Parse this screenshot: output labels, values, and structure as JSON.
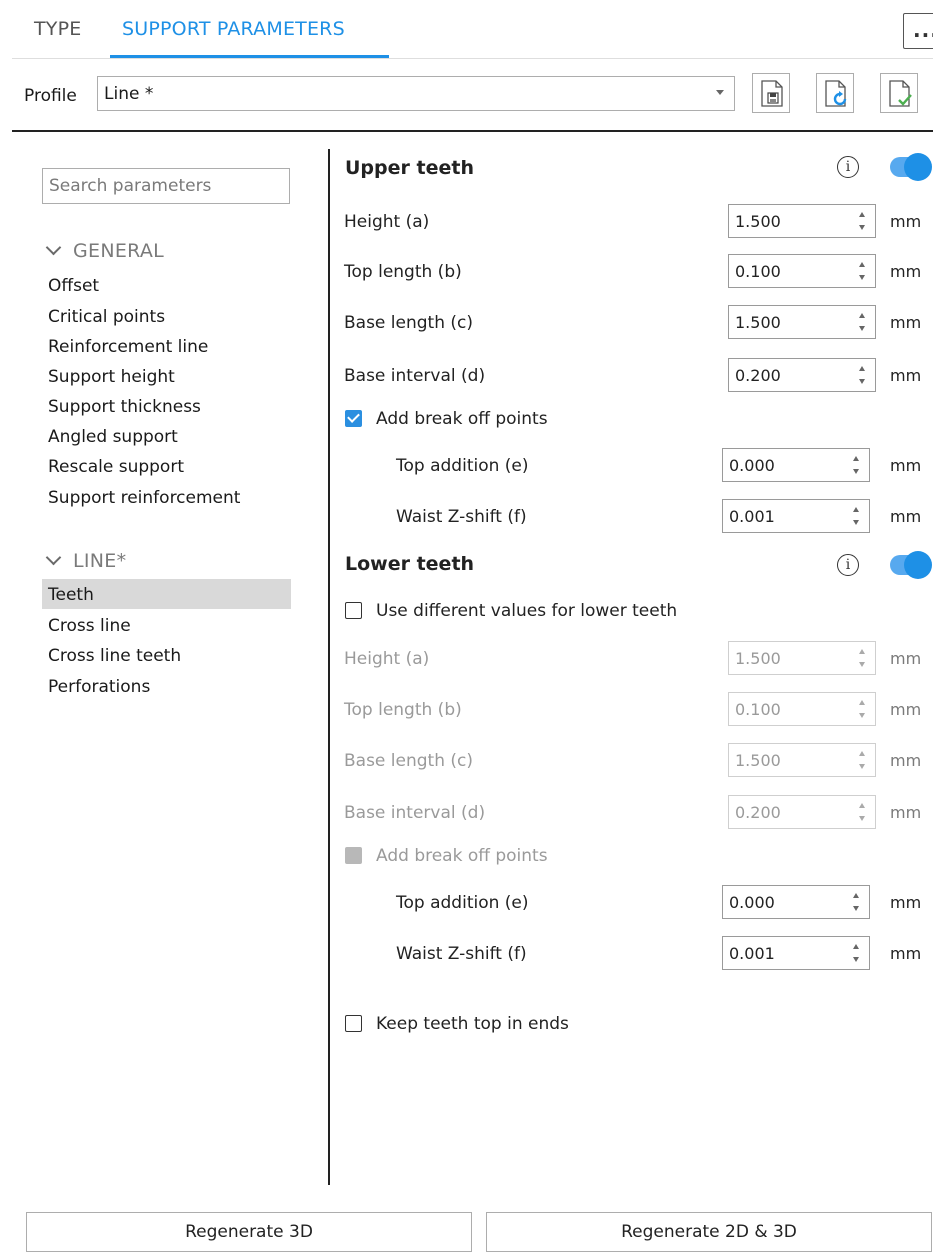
{
  "tabs": [
    {
      "label": "TYPE",
      "active": false
    },
    {
      "label": "SUPPORT PARAMETERS",
      "active": true
    }
  ],
  "more_button": {
    "label": "..."
  },
  "profile": {
    "label": "Profile",
    "selected": "Line *",
    "icons": [
      "save-profile-icon",
      "reset-profile-icon",
      "apply-profile-icon"
    ]
  },
  "sidebar": {
    "search_placeholder": "Search parameters",
    "groups": [
      {
        "title": "GENERAL",
        "items": [
          "Offset",
          "Critical points",
          "Reinforcement line",
          "Support height",
          "Support thickness",
          "Angled support",
          "Rescale support",
          "Support reinforcement"
        ]
      },
      {
        "title": "LINE*",
        "items": [
          "Teeth",
          "Cross line",
          "Cross line teeth",
          "Perforations"
        ]
      }
    ],
    "selected_item": "Teeth"
  },
  "upper": {
    "title": "Upper teeth",
    "enabled": true,
    "params": [
      {
        "label": "Height (a)",
        "value": "1.500",
        "unit": "mm"
      },
      {
        "label": "Top length (b)",
        "value": "0.100",
        "unit": "mm"
      },
      {
        "label": "Base length (c)",
        "value": "1.500",
        "unit": "mm"
      },
      {
        "label": "Base interval (d)",
        "value": "0.200",
        "unit": "mm"
      }
    ],
    "break_off": {
      "label": "Add break off points",
      "checked": true
    },
    "sub_params": [
      {
        "label": "Top addition (e)",
        "value": "0.000",
        "unit": "mm"
      },
      {
        "label": "Waist Z-shift (f)",
        "value": "0.001",
        "unit": "mm"
      }
    ]
  },
  "lower": {
    "title": "Lower teeth",
    "enabled": true,
    "use_different": {
      "label": "Use different values for lower teeth",
      "checked": false
    },
    "params": [
      {
        "label": "Height (a)",
        "value": "1.500",
        "unit": "mm"
      },
      {
        "label": "Top length (b)",
        "value": "0.100",
        "unit": "mm"
      },
      {
        "label": "Base length (c)",
        "value": "1.500",
        "unit": "mm"
      },
      {
        "label": "Base interval (d)",
        "value": "0.200",
        "unit": "mm"
      }
    ],
    "break_off": {
      "label": "Add break off points",
      "checked": true
    },
    "sub_params": [
      {
        "label": "Top addition (e)",
        "value": "0.000",
        "unit": "mm"
      },
      {
        "label": "Waist Z-shift (f)",
        "value": "0.001",
        "unit": "mm"
      }
    ]
  },
  "keep_teeth": {
    "label": "Keep teeth top in ends",
    "checked": false
  },
  "buttons": {
    "regen3d": "Regenerate 3D",
    "regen2d3d": "Regenerate 2D & 3D"
  },
  "colors": {
    "accent": "#1e90e6",
    "selection": "#d9d9d9"
  }
}
